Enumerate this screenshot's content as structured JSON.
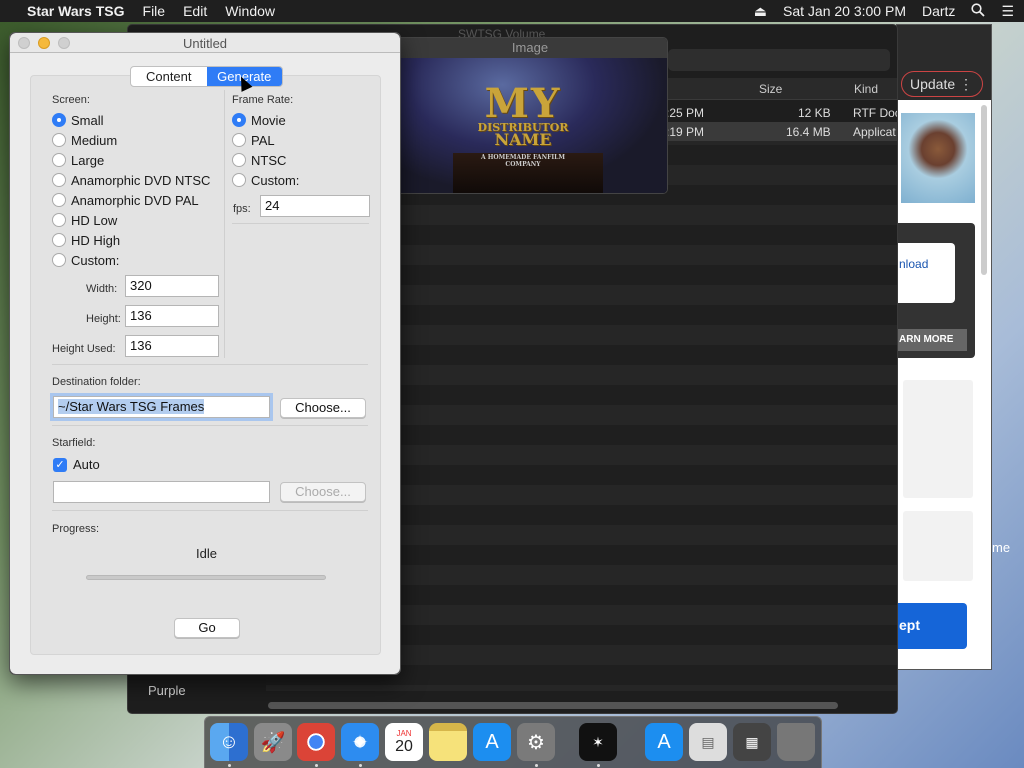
{
  "menubar": {
    "app_name": "Star Wars TSG",
    "menus": [
      "File",
      "Edit",
      "Window"
    ],
    "datetime": "Sat Jan 20  3:00 PM",
    "user": "Dartz"
  },
  "finder": {
    "title": "SWTSG Volume",
    "columns": {
      "size": "Size",
      "kind": "Kind"
    },
    "rows": [
      {
        "time": ":25 PM",
        "size": "12 KB",
        "kind": "RTF Doc"
      },
      {
        "time": ":19 PM",
        "size": "16.4 MB",
        "kind": "Applicat"
      }
    ],
    "sidebar_tag": "Purple"
  },
  "browser": {
    "update_label": "Update",
    "download_text": "nload",
    "learn_more": "ARN MORE",
    "accept": "ept",
    "side_text": "me"
  },
  "image_window": {
    "title": "Image",
    "logo_line1": "MY",
    "logo_line2": "DISTRIBUTOR",
    "logo_line3": "NAME",
    "logo_tagline": "A HOMEMADE FANFILM COMPANY"
  },
  "dialog": {
    "title": "Untitled",
    "tabs": [
      {
        "label": "Content",
        "active": false
      },
      {
        "label": "Generate",
        "active": true
      }
    ],
    "screen": {
      "label": "Screen:",
      "options": [
        "Small",
        "Medium",
        "Large",
        "Anamorphic DVD NTSC",
        "Anamorphic DVD PAL",
        "HD Low",
        "HD High",
        "Custom:"
      ],
      "selected": "Small"
    },
    "frame_rate": {
      "label": "Frame Rate:",
      "options": [
        "Movie",
        "PAL",
        "NTSC",
        "Custom:"
      ],
      "selected": "Movie",
      "fps_label": "fps:",
      "fps_value": "24"
    },
    "width_label": "Width:",
    "width_value": "320",
    "height_label": "Height:",
    "height_value": "136",
    "height_used_label": "Height Used:",
    "height_used_value": "136",
    "destination": {
      "label": "Destination folder:",
      "value": "~/Star Wars TSG Frames",
      "choose": "Choose..."
    },
    "starfield": {
      "label": "Starfield:",
      "auto_label": "Auto",
      "auto_checked": true,
      "value": "",
      "choose": "Choose..."
    },
    "progress": {
      "label": "Progress:",
      "status": "Idle",
      "fraction": 0
    },
    "go_label": "Go"
  },
  "dock": {
    "calendar_month": "JAN",
    "calendar_day": "20"
  },
  "colors": {
    "accent": "#2f7cf6",
    "menubar": "#1f1f1f",
    "dialog_bg": "#ececec"
  }
}
